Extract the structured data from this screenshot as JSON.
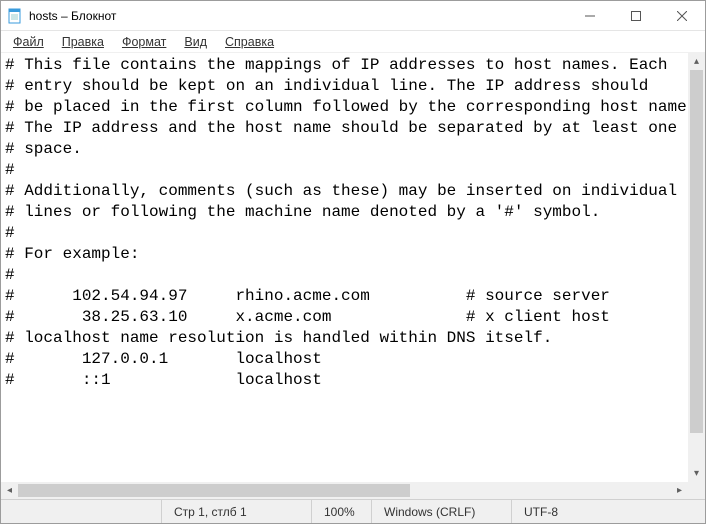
{
  "window": {
    "title": "hosts – Блокнот"
  },
  "menu": {
    "file": "Файл",
    "edit": "Правка",
    "format": "Формат",
    "view": "Вид",
    "help": "Справка"
  },
  "editor": {
    "content": "# This file contains the mappings of IP addresses to host names. Each\n# entry should be kept on an individual line. The IP address should\n# be placed in the first column followed by the corresponding host name.\n# The IP address and the host name should be separated by at least one\n# space.\n#\n# Additionally, comments (such as these) may be inserted on individual\n# lines or following the machine name denoted by a '#' symbol.\n#\n# For example:\n#\n#      102.54.94.97     rhino.acme.com          # source server\n#       38.25.63.10     x.acme.com              # x client host\n# localhost name resolution is handled within DNS itself.\n#       127.0.0.1       localhost\n#       ::1             localhost\n"
  },
  "status": {
    "position": "Стр 1, стлб 1",
    "zoom": "100%",
    "line_ending": "Windows (CRLF)",
    "encoding": "UTF-8"
  }
}
